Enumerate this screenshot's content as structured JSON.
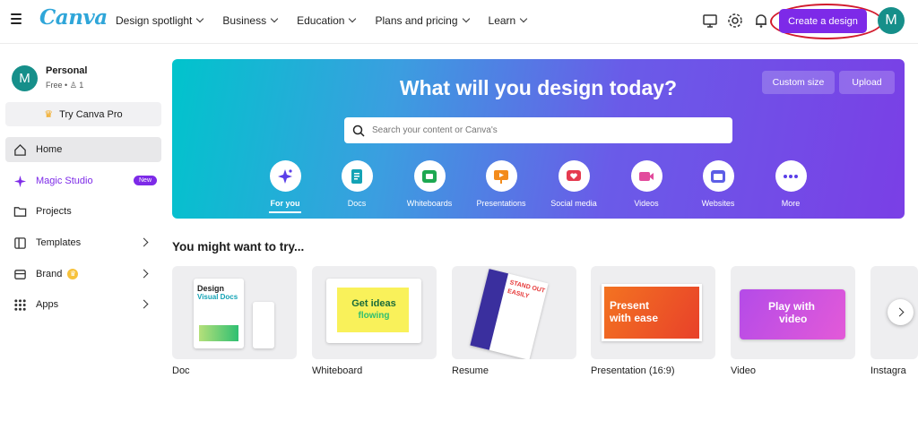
{
  "header": {
    "logo": "Canva",
    "nav": [
      "Design spotlight",
      "Business",
      "Education",
      "Plans and pricing",
      "Learn"
    ],
    "create_label": "Create a design",
    "avatar_initial": "M"
  },
  "sidebar": {
    "account_initial": "M",
    "account_name": "Personal",
    "account_plan": "Free •",
    "account_members": "1",
    "pro_label": "Try Canva Pro",
    "items": [
      {
        "label": "Home"
      },
      {
        "label": "Magic Studio",
        "badge": "New"
      },
      {
        "label": "Projects"
      },
      {
        "label": "Templates"
      },
      {
        "label": "Brand"
      },
      {
        "label": "Apps"
      }
    ]
  },
  "hero": {
    "title": "What will you design today?",
    "custom_size": "Custom size",
    "upload": "Upload",
    "search_placeholder": "Search your content or Canva's",
    "categories": [
      "For you",
      "Docs",
      "Whiteboards",
      "Presentations",
      "Social media",
      "Videos",
      "Websites",
      "More"
    ]
  },
  "suggestions": {
    "title": "You might want to try...",
    "cards": [
      {
        "label": "Doc",
        "art_text_1": "Design",
        "art_text_2": "Visual Docs"
      },
      {
        "label": "Whiteboard",
        "art_text_1": "Get ideas",
        "art_text_2": "flowing"
      },
      {
        "label": "Resume",
        "art_text_1": "STAND OUT",
        "art_text_2": "EASILY"
      },
      {
        "label": "Presentation (16:9)",
        "art_text_1": "Present",
        "art_text_2": "with ease"
      },
      {
        "label": "Video",
        "art_text_1": "Play with",
        "art_text_2": "video"
      },
      {
        "label": "Instagra"
      }
    ]
  },
  "colors": {
    "brand_purple": "#7d2ae8",
    "teal": "#168f8a",
    "highlight_red": "#d21a2c"
  }
}
